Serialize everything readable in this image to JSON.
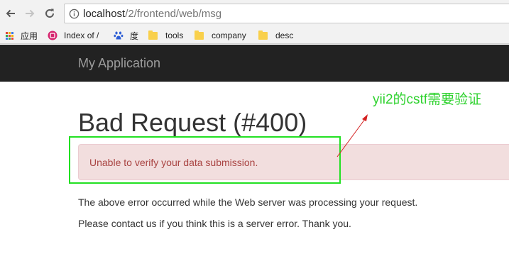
{
  "browser": {
    "url_host": "localhost",
    "url_path": "/2/frontend/web/msg",
    "bookmarks": [
      {
        "label": "应用",
        "icon": "apps-grid-icon"
      },
      {
        "label": "Index of /",
        "icon": "site-favicon-icon"
      },
      {
        "label": "度",
        "icon": "baidu-paw-icon"
      },
      {
        "label": "tools",
        "icon": "folder-icon"
      },
      {
        "label": "company",
        "icon": "folder-icon"
      },
      {
        "label": "desc",
        "icon": "folder-icon"
      }
    ]
  },
  "navbar": {
    "brand": "My Application"
  },
  "error": {
    "title": "Bad Request (#400)",
    "message": "Unable to verify your data submission.",
    "para1": "The above error occurred while the Web server was processing your request.",
    "para2": "Please contact us if you think this is a server error. Thank you."
  },
  "annotation": {
    "note": "yii2的cstf需要验证",
    "color": "#2fd22f"
  },
  "colors": {
    "navbar_bg": "#222222",
    "alert_bg": "#f2dede",
    "alert_text": "#a94442",
    "highlight": "#22e022"
  }
}
